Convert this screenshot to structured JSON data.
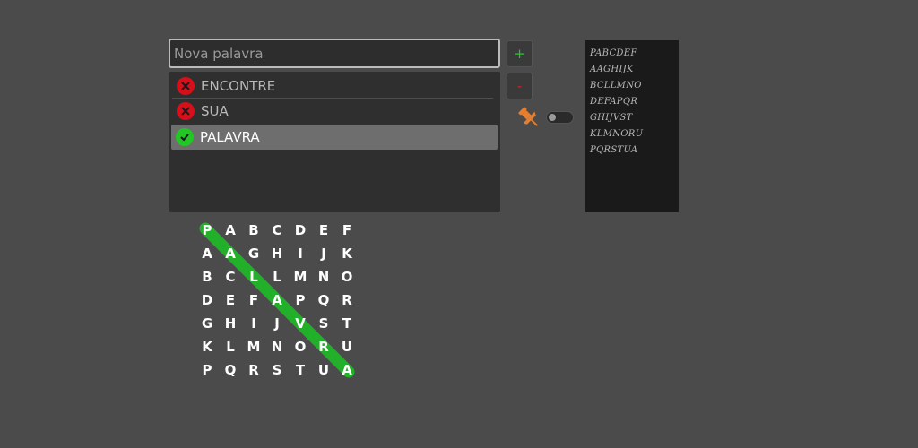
{
  "input": {
    "placeholder": "Nova palavra",
    "value": ""
  },
  "buttons": {
    "add_label": "+",
    "remove_label": "-"
  },
  "words": [
    {
      "text": "ENCONTRE",
      "found": false
    },
    {
      "text": "SUA",
      "found": false
    },
    {
      "text": "PALAVRA",
      "found": true
    }
  ],
  "toggle": {
    "on": false
  },
  "preview_lines": [
    "PABCDEF",
    "AAGHIJK",
    "BCLLMNO",
    "DEFAPQR",
    "GHIJVST",
    "KLMNORU",
    "PQRSTUA"
  ],
  "grid": {
    "rows": [
      [
        "P",
        "A",
        "B",
        "C",
        "D",
        "E",
        "F"
      ],
      [
        "A",
        "A",
        "G",
        "H",
        "I",
        "J",
        "K"
      ],
      [
        "B",
        "C",
        "L",
        "L",
        "M",
        "N",
        "O"
      ],
      [
        "D",
        "E",
        "F",
        "A",
        "P",
        "Q",
        "R"
      ],
      [
        "G",
        "H",
        "I",
        "J",
        "V",
        "S",
        "T"
      ],
      [
        "K",
        "L",
        "M",
        "N",
        "O",
        "R",
        "U"
      ],
      [
        "P",
        "Q",
        "R",
        "S",
        "T",
        "U",
        "A"
      ]
    ],
    "highlight": {
      "from": [
        0,
        0
      ],
      "to": [
        6,
        6
      ],
      "color": "#22b02a"
    }
  },
  "colors": {
    "background": "#4b4b4b",
    "found": "#22c625",
    "not_found": "#d80f1a",
    "pin": "#e67e2e"
  },
  "icons": {
    "add": "plus-icon",
    "remove": "minus-icon",
    "pin": "pin-icon",
    "not_found": "x-circle-icon",
    "found": "check-circle-icon"
  }
}
